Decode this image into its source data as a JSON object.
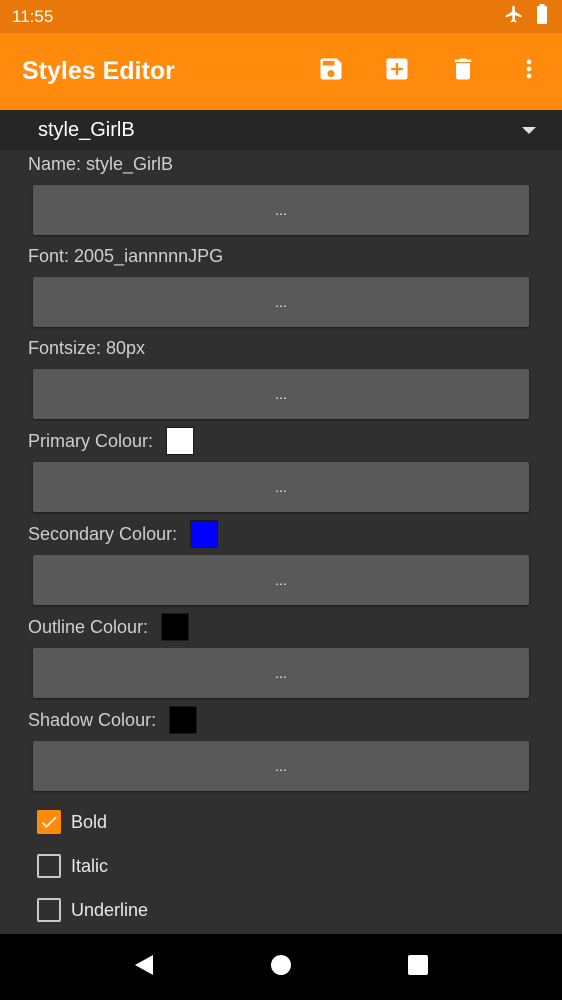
{
  "status_bar": {
    "time": "11:55",
    "icons": [
      "airplane-icon",
      "battery-icon"
    ]
  },
  "app_bar": {
    "title": "Styles Editor",
    "actions": [
      "save-icon",
      "add-box-icon",
      "delete-icon",
      "more-vert-icon"
    ]
  },
  "style_selector": {
    "selected": "style_GirlB"
  },
  "fields": {
    "name": {
      "label": "Name: style_GirlB",
      "button": "..."
    },
    "font": {
      "label": "Font: 2005_iannnnnJPG",
      "button": "..."
    },
    "fontsize": {
      "label": "Fontsize: 80px",
      "button": "..."
    },
    "primary_colour": {
      "label": "Primary Colour:",
      "color": "#ffffff",
      "button": "..."
    },
    "secondary_colour": {
      "label": "Secondary Colour:",
      "color": "#0000ff",
      "button": "..."
    },
    "outline_colour": {
      "label": "Outline Colour:",
      "color": "#000000",
      "button": "..."
    },
    "shadow_colour": {
      "label": "Shadow Colour:",
      "color": "#000000",
      "button": "..."
    }
  },
  "checkboxes": {
    "bold": {
      "label": "Bold",
      "checked": true
    },
    "italic": {
      "label": "Italic",
      "checked": false
    },
    "underline": {
      "label": "Underline",
      "checked": false
    }
  },
  "colors": {
    "accent": "#ff8a0c",
    "status_bar": "#e8780a",
    "background": "#303030"
  },
  "nav_bar": [
    "back-icon",
    "home-icon",
    "recents-icon"
  ]
}
